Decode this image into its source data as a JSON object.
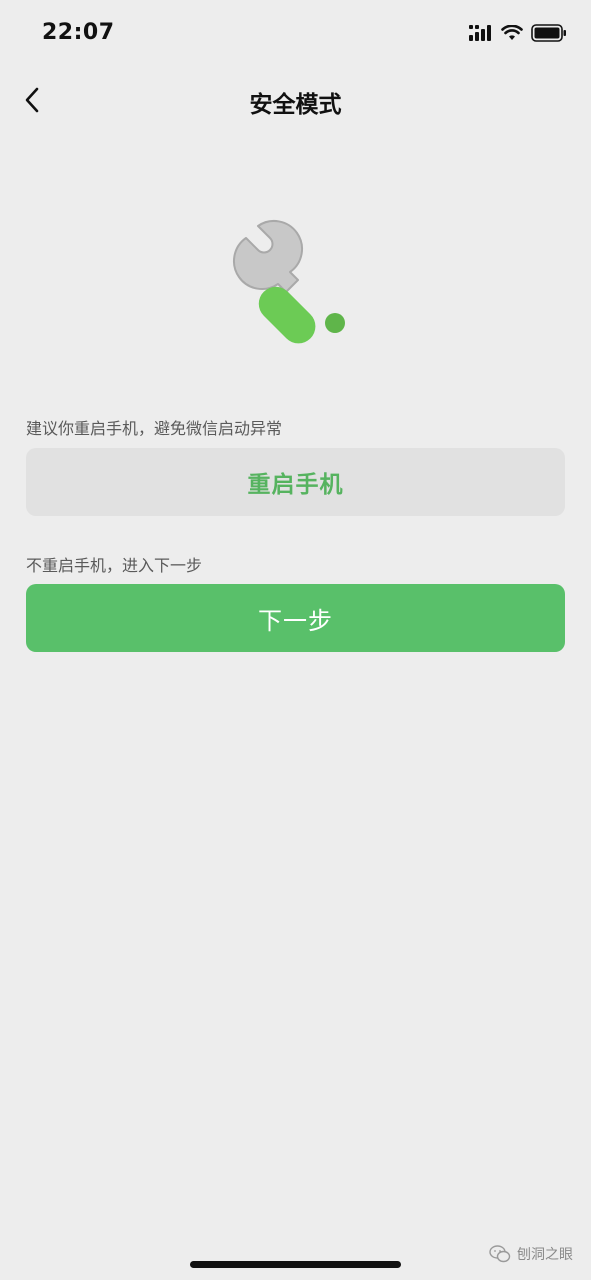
{
  "status_bar": {
    "time": "22:07",
    "icons": [
      "cellular-signal-icon",
      "wifi-icon",
      "battery-icon"
    ]
  },
  "nav": {
    "title": "安全模式",
    "back_icon": "chevron-left-icon"
  },
  "illustration": {
    "icon": "wrench-icon",
    "colors": {
      "head": "#c8c8c8",
      "handle": "#6ccb55",
      "handle_dot": "#5fb54a"
    }
  },
  "restart_section": {
    "hint": "建议你重启手机，避免微信启动异常",
    "button_label": "重启手机"
  },
  "next_section": {
    "hint": "不重启手机，进入下一步",
    "button_label": "下一步"
  },
  "watermark": {
    "text": "刨洞之眼",
    "icon": "wechat-logo-icon"
  },
  "colors": {
    "background": "#ededed",
    "accent": "#59c06a",
    "accent_text": "#56b35f",
    "secondary_button": "#e1e1e1"
  }
}
